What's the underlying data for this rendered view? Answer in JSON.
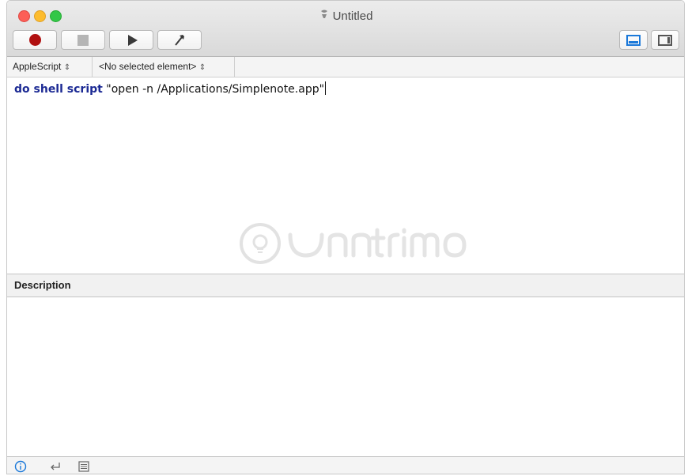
{
  "window": {
    "title": "Untitled",
    "title_icon": "script-document-icon"
  },
  "toolbar": {
    "buttons": [
      {
        "name": "record",
        "icon": "record-icon"
      },
      {
        "name": "stop",
        "icon": "stop-icon"
      },
      {
        "name": "run",
        "icon": "play-icon"
      },
      {
        "name": "compile",
        "icon": "hammer-icon"
      }
    ],
    "view_toggles": [
      {
        "name": "show-bottom-pane",
        "icon": "bottom-pane-icon",
        "active": true
      },
      {
        "name": "show-right-pane",
        "icon": "right-pane-icon",
        "active": false
      }
    ]
  },
  "navbar": {
    "language": "AppleScript",
    "element": "<No selected element>",
    "popup_arrow": "⌃⌄"
  },
  "editor": {
    "keyword": "do shell script",
    "string": "\"open -n /Applications/Simplenote.app\""
  },
  "description": {
    "header": "Description"
  },
  "bottombar": {
    "icons": [
      "info-icon",
      "return-icon",
      "list-icon"
    ]
  },
  "colors": {
    "keyword": "#1c2a94",
    "accent": "#1a78d9",
    "record": "#b01010"
  }
}
